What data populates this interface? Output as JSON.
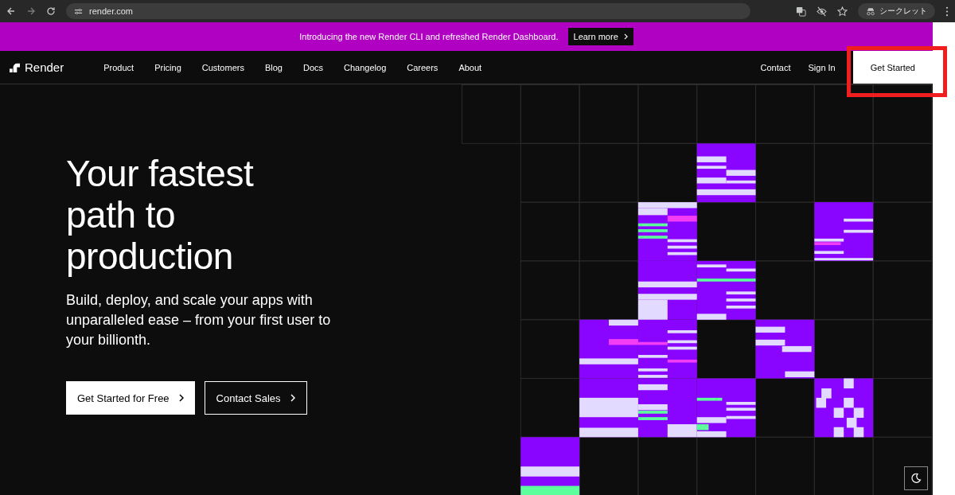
{
  "browser": {
    "url": "render.com",
    "profile_label": "シークレット"
  },
  "banner": {
    "text": "Introducing the new Render CLI and refreshed Render Dashboard.",
    "link": "Learn more"
  },
  "nav": {
    "brand": "Render",
    "items": [
      "Product",
      "Pricing",
      "Customers",
      "Blog",
      "Docs",
      "Changelog",
      "Careers",
      "About"
    ],
    "right_items": [
      "Contact",
      "Sign In"
    ],
    "cta": {
      "label": "Get Started",
      "annotated": true
    }
  },
  "hero": {
    "title": "Your fastest path to production",
    "subtitle": "Build, deploy, and scale your apps with unparalleled ease – from your first user to your billionth.",
    "buttons": [
      {
        "label": "Get Started for Free",
        "kind": "primary"
      },
      {
        "label": "Contact Sales",
        "kind": "secondary"
      }
    ]
  }
}
